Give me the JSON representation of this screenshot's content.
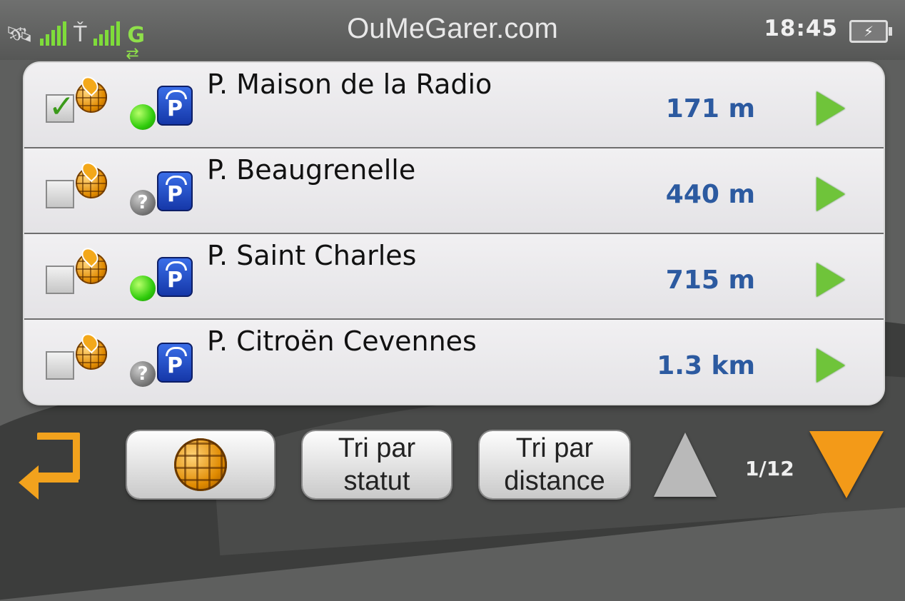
{
  "status_bar": {
    "signal_icon": "satellite-signal-icon",
    "antenna_icon": "antenna-signal-icon",
    "network_label": "G",
    "title": "OuMeGarer.com",
    "time": "18:45",
    "battery_icon": "battery-charging-icon"
  },
  "list": {
    "items": [
      {
        "name": "P. Maison de la Radio",
        "distance": "171 m",
        "checked": true,
        "status": "available"
      },
      {
        "name": "P. Beaugrenelle",
        "distance": "440 m",
        "checked": false,
        "status": "unknown"
      },
      {
        "name": "P. Saint Charles",
        "distance": "715 m",
        "checked": false,
        "status": "available"
      },
      {
        "name": "P. Citroën Cevennes",
        "distance": "1.3 km",
        "checked": false,
        "status": "unknown"
      }
    ]
  },
  "toolbar": {
    "back_icon": "back-arrow-icon",
    "map_icon": "globe-map-icon",
    "sort_status_line1": "Tri par",
    "sort_status_line2": "statut",
    "sort_distance_line1": "Tri par",
    "sort_distance_line2": "distance",
    "page_indicator": "1/12"
  },
  "colors": {
    "accent_orange": "#f39a18",
    "distance_blue": "#2c5aa0",
    "status_green": "#2fcb0c",
    "arrow_green": "#6fc43a"
  }
}
